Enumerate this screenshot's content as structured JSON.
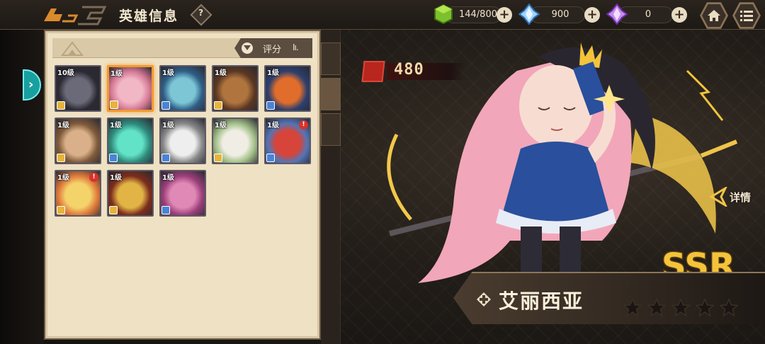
{
  "header": {
    "title": "英雄信息",
    "help_symbol": "?"
  },
  "resources": [
    {
      "name": "stamina",
      "icon": "green-cube-icon",
      "value": "144/800"
    },
    {
      "name": "diamond",
      "icon": "blue-crystal-icon",
      "value": "900"
    },
    {
      "name": "star-crystal",
      "icon": "purple-crystal-icon",
      "value": "0"
    }
  ],
  "nav": {
    "home_icon": "home-icon",
    "menu_icon": "menu-icon",
    "side_tab_arrow": "›"
  },
  "panel": {
    "sort_label": "评分",
    "sort_icon": "Iı.",
    "heroes": [
      {
        "level": "10级",
        "class": "gold",
        "selected": false,
        "alert": false,
        "palette": [
          "#6b6a78",
          "#2b2a33"
        ]
      },
      {
        "level": "1级",
        "class": "gold",
        "selected": true,
        "alert": false,
        "palette": [
          "#f1b7c4",
          "#d77b98"
        ]
      },
      {
        "level": "1级",
        "class": "blue",
        "selected": false,
        "alert": false,
        "palette": [
          "#7cc6d6",
          "#2f5e86"
        ]
      },
      {
        "level": "1级",
        "class": "gold",
        "selected": false,
        "alert": false,
        "palette": [
          "#b0753e",
          "#5a3723"
        ]
      },
      {
        "level": "1级",
        "class": "blue",
        "selected": false,
        "alert": false,
        "palette": [
          "#e06d2c",
          "#2c3f6e"
        ]
      },
      {
        "level": "1级",
        "class": "gold",
        "selected": false,
        "alert": false,
        "palette": [
          "#d9b089",
          "#7f5a3a"
        ]
      },
      {
        "level": "1级",
        "class": "blue",
        "selected": false,
        "alert": false,
        "palette": [
          "#62e2c6",
          "#2f8a7c"
        ]
      },
      {
        "level": "1级",
        "class": "blue",
        "selected": false,
        "alert": false,
        "palette": [
          "#eeeeee",
          "#888888"
        ]
      },
      {
        "level": "1级",
        "class": "gold",
        "selected": false,
        "alert": false,
        "palette": [
          "#f0eee4",
          "#a3c089"
        ]
      },
      {
        "level": "1级",
        "class": "blue",
        "selected": false,
        "alert": true,
        "palette": [
          "#d6443a",
          "#5475b6"
        ]
      },
      {
        "level": "1级",
        "class": "gold",
        "selected": false,
        "alert": true,
        "palette": [
          "#f4d36b",
          "#e07a3c"
        ]
      },
      {
        "level": "1级",
        "class": "gold",
        "selected": false,
        "alert": false,
        "palette": [
          "#e2b446",
          "#7c2d1c"
        ]
      },
      {
        "level": "1级",
        "class": "blue",
        "selected": false,
        "alert": false,
        "palette": [
          "#e189b6",
          "#9b3f7a"
        ]
      }
    ]
  },
  "hero": {
    "power": "480",
    "name": "艾丽西亚",
    "rarity": "SSR",
    "stars_total": 5,
    "stars_filled": 0,
    "detail_label": "详情",
    "colors": {
      "hair": "#f2a6b9",
      "dress": "#2a4f9c",
      "accent": "#f3c43a"
    }
  }
}
